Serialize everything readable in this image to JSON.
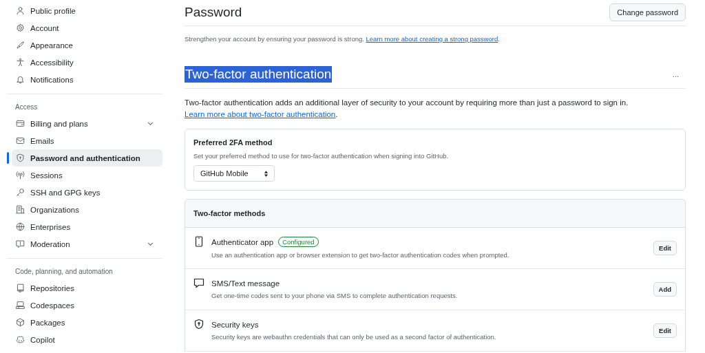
{
  "sidebar": {
    "groups": [
      {
        "items": [
          {
            "label": "Public profile",
            "selected": false
          },
          {
            "label": "Account",
            "selected": false
          },
          {
            "label": "Appearance",
            "selected": false
          },
          {
            "label": "Accessibility",
            "selected": false
          },
          {
            "label": "Notifications",
            "selected": false
          }
        ]
      },
      {
        "heading": "Access",
        "items": [
          {
            "label": "Billing and plans",
            "selected": false,
            "expandable": true
          },
          {
            "label": "Emails",
            "selected": false
          },
          {
            "label": "Password and authentication",
            "selected": true
          },
          {
            "label": "Sessions",
            "selected": false
          },
          {
            "label": "SSH and GPG keys",
            "selected": false
          },
          {
            "label": "Organizations",
            "selected": false
          },
          {
            "label": "Enterprises",
            "selected": false
          },
          {
            "label": "Moderation",
            "selected": false,
            "expandable": true
          }
        ]
      },
      {
        "heading": "Code, planning, and automation",
        "items": [
          {
            "label": "Repositories",
            "selected": false
          },
          {
            "label": "Codespaces",
            "selected": false
          },
          {
            "label": "Packages",
            "selected": false
          },
          {
            "label": "Copilot",
            "selected": false
          }
        ]
      }
    ]
  },
  "password": {
    "title": "Password",
    "button": "Change password",
    "text": "Strengthen your account by ensuring your password is strong.",
    "link": "Learn more about creating a strong password",
    "after": "."
  },
  "two_factor": {
    "title": "Two-factor authentication",
    "title_selected": true,
    "menu": "...",
    "text": "Two-factor authentication adds an additional layer of security to your account by requiring more than just a password to sign in.",
    "link": "Learn more about two-factor authentication",
    "after": ".",
    "preferred": {
      "title": "Preferred 2FA method",
      "description": "Set your preferred method to use for two-factor authentication when signing into GitHub.",
      "value": "GitHub Mobile"
    },
    "methods": {
      "title": "Two-factor methods",
      "rows": [
        {
          "title": "Authenticator app",
          "badge": "Configured",
          "description": "Use an authentication app or browser extension to get two-factor authentication codes when prompted.",
          "button": "Edit"
        },
        {
          "title": "SMS/Text message",
          "description": "Get one-time codes sent to your phone via SMS to complete authentication requests.",
          "button": "Add"
        },
        {
          "title": "Security keys",
          "description": "Security keys are webauthn credentials that can only be used as a second factor of authentication.",
          "button": "Edit"
        }
      ]
    }
  }
}
